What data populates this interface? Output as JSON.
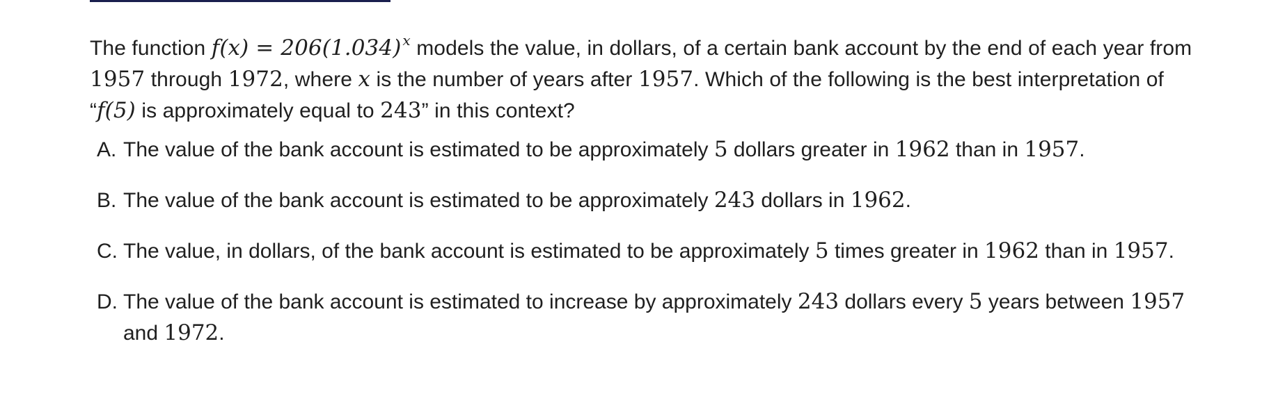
{
  "question": {
    "intro": "The function ",
    "func": "f(x) = 206(1.034)",
    "exponent": "x",
    "p1": " models the value, in dollars, of a certain bank account by the end of each year from ",
    "y1957": "1957",
    "through": " through ",
    "y1972": "1972",
    "where": ", where ",
    "var_x": "x",
    "p2": " is the number of years after ",
    "y1957b": "1957",
    "p3": ". Which of the following is the best interpretation of “",
    "f5": "f(5)",
    "p4": " is approximately equal to ",
    "v243": "243",
    "p5": "” in this context?"
  },
  "options": [
    {
      "letter": "A.",
      "parts": [
        "The value of the bank account is estimated to be approximately ",
        "5",
        " dollars greater in ",
        "1962",
        " than in ",
        "1957",
        "."
      ]
    },
    {
      "letter": "B.",
      "parts": [
        "The value of the bank account is estimated to be approximately ",
        "243",
        " dollars in ",
        "1962",
        "."
      ]
    },
    {
      "letter": "C.",
      "parts": [
        "The value, in dollars, of the bank account is estimated to be approximately ",
        "5",
        " times greater in ",
        "1962",
        " than in ",
        "1957",
        "."
      ]
    },
    {
      "letter": "D.",
      "parts": [
        "The value of the bank account is estimated to increase by approximately ",
        "243",
        " dollars every ",
        "5",
        " years between ",
        "1957",
        " and ",
        "1972",
        "."
      ]
    }
  ]
}
